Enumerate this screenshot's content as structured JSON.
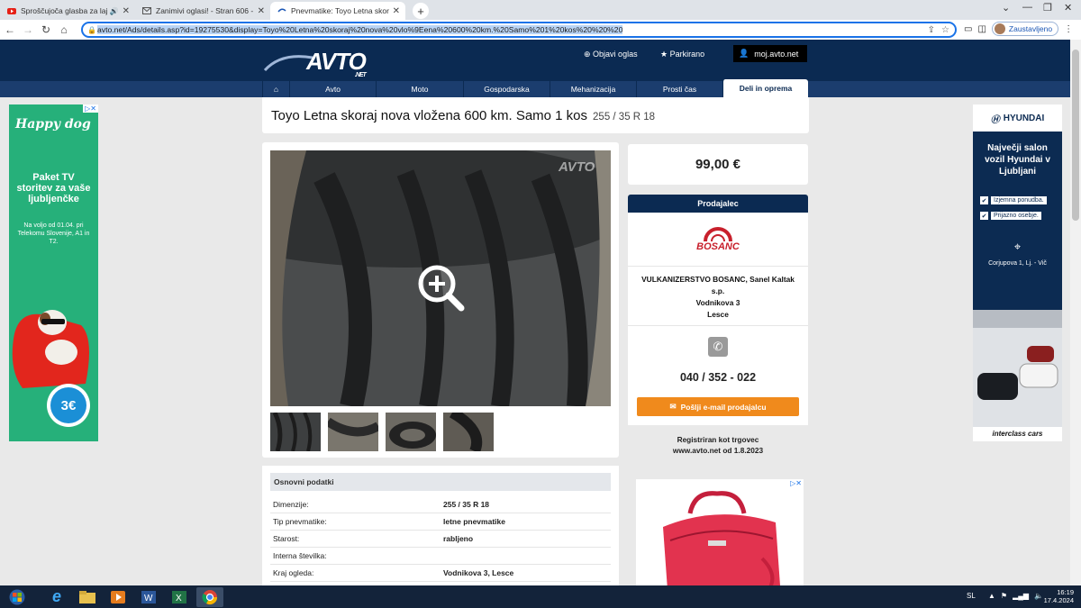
{
  "tabs": [
    {
      "title": "Sproščujoča glasba za lajšanj",
      "active": false
    },
    {
      "title": "Zanimivi oglasi! - Stran 606 - Sp",
      "active": false
    },
    {
      "title": "Pnevmatike: Toyo Letna skoraj n",
      "active": true
    }
  ],
  "browser": {
    "url": "avto.net/Ads/details.asp?id=19275530&display=Toyo%20Letna%20skoraj%20nova%20vlo%9Eena%20600%20km.%20Samo%201%20kos%20%20%20",
    "profile_label": "Zaustavljeno"
  },
  "site": {
    "logo": "AVTO",
    "logo_sub": ".NET",
    "header_links": [
      "Objavi oglas",
      "Parkirano",
      "moj.avto.net"
    ],
    "menu": [
      "Avto",
      "Moto",
      "Gospodarska",
      "Mehanizacija",
      "Prosti čas",
      "Deli in oprema"
    ]
  },
  "ad": {
    "title": "Toyo Letna skoraj nova vložena 600 km. Samo 1 kos",
    "dimension": "255 / 35  R 18",
    "price": "99,00 €",
    "seller_header": "Prodajalec",
    "seller_logo": "BOSANC",
    "seller_name": "VULKANIZERSTVO BOSANC, Sanel Kaltak s.p.",
    "seller_street": "Vodnikova 3",
    "seller_city": "Lesce",
    "phone": "040 / 352 - 022",
    "email_button": "Pošlji e-mail prodajalcu",
    "registered_1": "Registriran kot trgovec",
    "registered_2": "www.avto.net od 1.8.2023",
    "photo_watermark": "AVTO"
  },
  "basic": {
    "header": "Osnovni podatki",
    "rows": [
      {
        "k": "Dimenzije:",
        "v": "255 / 35  R 18"
      },
      {
        "k": "Tip pnevmatike:",
        "v": "letne pnevmatike"
      },
      {
        "k": "Starost:",
        "v": "rabljeno"
      },
      {
        "k": "Interna številka:",
        "v": ""
      },
      {
        "k": "Kraj ogleda:",
        "v": "Vodnikova 3, Lesce"
      }
    ]
  },
  "ads": {
    "left": {
      "brand": "Happy dog",
      "text": "Paket TV storitev za vaše ljubljenčke",
      "small": "Na voljo od 01.04. pri Telekomu Slovenije, A1 in T2.",
      "price": "3€"
    },
    "right": {
      "brand": "HYUNDAI",
      "headline": "Največji salon vozil Hyundai v Ljubljani",
      "b1": "Izjemna ponudba.",
      "b2": "Prijazno osebje.",
      "address": "Corjupova 1, Lj. - Vič",
      "footer": "interclass cars"
    }
  },
  "taskbar": {
    "lang": "SL",
    "time": "16:19",
    "date": "17.4.2024"
  },
  "colors": {
    "header": "#0b2a52",
    "menu": "#1b3d6e",
    "button": "#f08a1c"
  }
}
